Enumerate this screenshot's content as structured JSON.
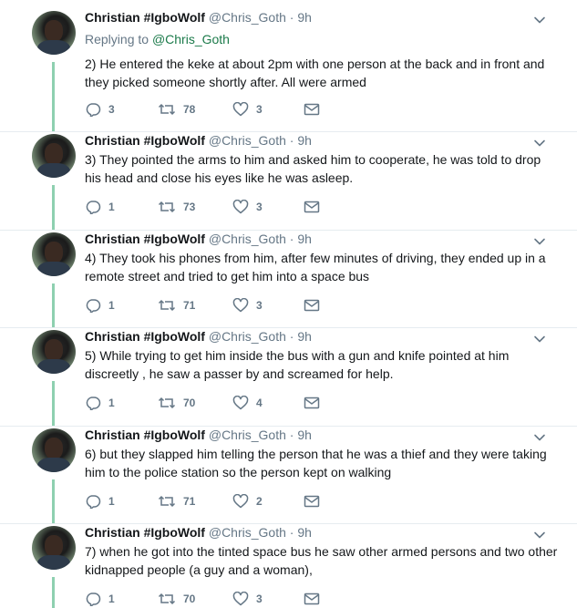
{
  "tweets": [
    {
      "name": "Christian #IgboWolf",
      "handle": "@Chris_Goth",
      "time": "9h",
      "replying_label": "Replying to",
      "replying_to": "@Chris_Goth",
      "text": "2) He entered the keke at about 2pm with one person at the back and in front and they picked someone shortly after. All were armed",
      "replies": "3",
      "retweets": "78",
      "likes": "3"
    },
    {
      "name": "Christian #IgboWolf",
      "handle": "@Chris_Goth",
      "time": "9h",
      "text": "3) They pointed the arms to him and asked him to cooperate, he was told to drop his head and close his eyes like he was asleep.",
      "replies": "1",
      "retweets": "73",
      "likes": "3"
    },
    {
      "name": "Christian #IgboWolf",
      "handle": "@Chris_Goth",
      "time": "9h",
      "text": "4) They took his phones from him, after few minutes of driving, they ended up in a remote street and tried to get  him into a space bus",
      "replies": "1",
      "retweets": "71",
      "likes": "3"
    },
    {
      "name": "Christian #IgboWolf",
      "handle": "@Chris_Goth",
      "time": "9h",
      "text": "5) While trying to get him inside the bus with a gun and knife pointed at him discreetly , he saw a passer by and screamed for help.",
      "replies": "1",
      "retweets": "70",
      "likes": "4"
    },
    {
      "name": "Christian #IgboWolf",
      "handle": "@Chris_Goth",
      "time": "9h",
      "text": "6) but they slapped him telling the person that he was a thief and they were taking him to the police station so the person kept on walking",
      "replies": "1",
      "retweets": "71",
      "likes": "2"
    },
    {
      "name": "Christian #IgboWolf",
      "handle": "@Chris_Goth",
      "time": "9h",
      "text": "7) when he got into the tinted space bus he saw other armed persons and two other kidnapped people (a guy and a woman),",
      "replies": "1",
      "retweets": "70",
      "likes": "3"
    }
  ],
  "colors": {
    "thread_line": "#8ed0b0",
    "mention": "#1b7a4a",
    "muted": "#657786"
  },
  "icons": {
    "reply": "reply-icon",
    "retweet": "retweet-icon",
    "like": "heart-icon",
    "dm": "envelope-icon",
    "more": "chevron-down-icon"
  }
}
